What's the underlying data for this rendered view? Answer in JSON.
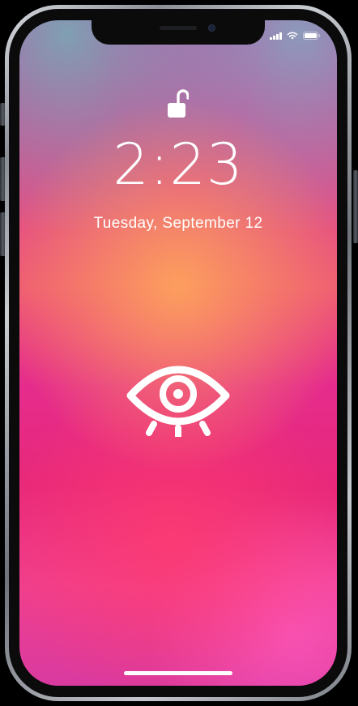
{
  "status_bar": {
    "icons": [
      "signal-icon",
      "wifi-icon",
      "battery-icon"
    ]
  },
  "lock_screen": {
    "lock_state_icon": "unlocked-padlock-icon",
    "time": "2:23",
    "date": "Tuesday, September 12",
    "center_icon": "eye-icon"
  },
  "colors": {
    "wallpaper_top": "#c63ca6",
    "wallpaper_middle": "#ee5a73",
    "wallpaper_bottom": "#e8287a",
    "text": "#ffffff"
  }
}
